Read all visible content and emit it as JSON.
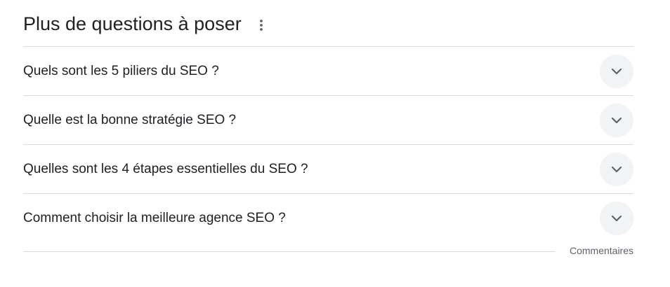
{
  "paa": {
    "title": "Plus de questions à poser",
    "more_icon": "more-vert-icon",
    "questions": [
      {
        "text": "Quels sont les 5 piliers du SEO ?",
        "icon": "chevron-down-icon"
      },
      {
        "text": "Quelle est la bonne stratégie SEO ?",
        "icon": "chevron-down-icon"
      },
      {
        "text": "Quelles sont les 4 étapes essentielles du SEO ?",
        "icon": "chevron-down-icon"
      },
      {
        "text": "Comment choisir la meilleure agence SEO ?",
        "icon": "chevron-down-icon"
      }
    ]
  },
  "footer": {
    "feedback_label": "Commentaires"
  },
  "colors": {
    "text": "#202124",
    "divider": "#dadce0",
    "chevron_bg": "#f1f3f4",
    "icon": "#5f6368"
  }
}
